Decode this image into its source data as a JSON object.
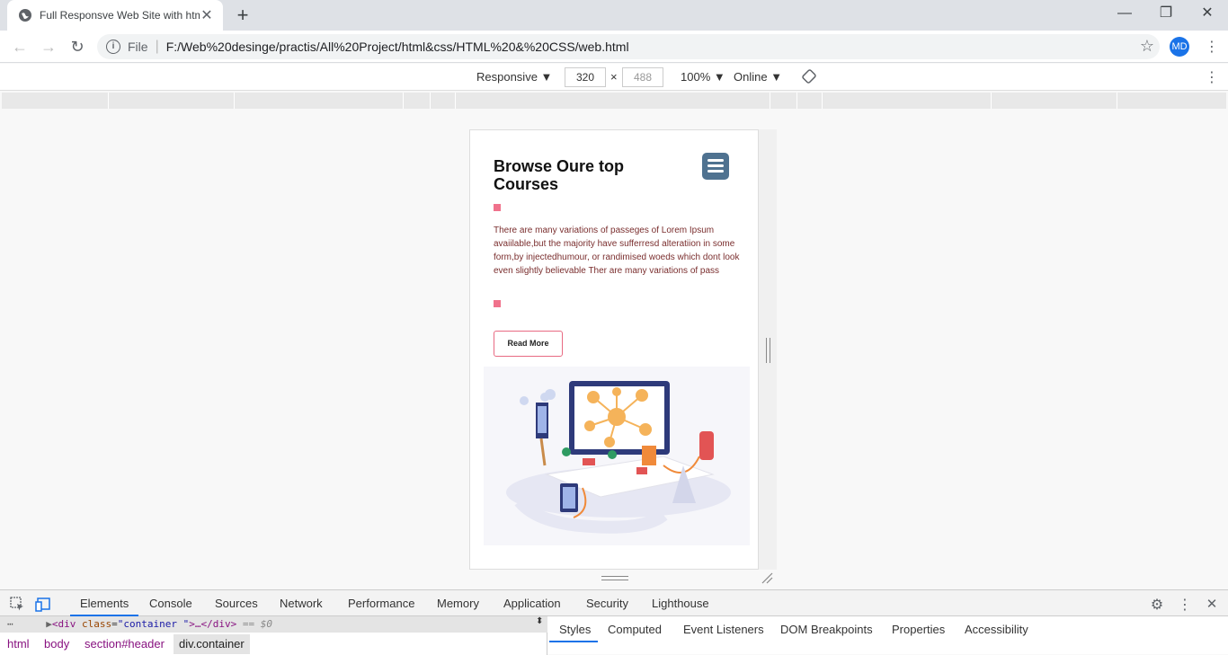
{
  "browser": {
    "tab_title": "Full Responsve Web Site with htm",
    "tab_close": "✕",
    "new_tab": "+",
    "window_controls": {
      "minimize": "—",
      "restore": "❐",
      "close": "✕"
    },
    "file_label": "File",
    "url": "F:/Web%20desinge/practis/All%20Project/html&css/HTML%20&%20CSS/web.html",
    "profile_initials": "MD"
  },
  "device_toolbar": {
    "mode": "Responsive ▼",
    "width": "320",
    "times": "×",
    "height": "488",
    "zoom": "100% ▼",
    "network": "Online ▼"
  },
  "page": {
    "title": "Browse Oure top Courses",
    "paragraph": "There are many variations of passeges of Lorem Ipsum avaiilable,but the majority have sufferresd alteratiion in some form,by injectedhumour, or randimised woeds which dont look even slightly believable Ther are many variations of pass",
    "read_more": "Read More",
    "colors": {
      "accent": "#f0728c",
      "menu": "#4f7290",
      "text": "#7a2e2e"
    }
  },
  "devtools": {
    "tabs": [
      "Elements",
      "Console",
      "Sources",
      "Network",
      "Performance",
      "Memory",
      "Application",
      "Security",
      "Lighthouse"
    ],
    "dom_line": {
      "open": "<div",
      "attr": "class",
      "value": "\"container \"",
      "rest": ">…</div>",
      "ref": "== $0"
    },
    "breadcrumbs": [
      "html",
      "body",
      "section#header",
      "div.container"
    ],
    "style_tabs": [
      "Styles",
      "Computed",
      "Event Listeners",
      "DOM Breakpoints",
      "Properties",
      "Accessibility"
    ]
  }
}
